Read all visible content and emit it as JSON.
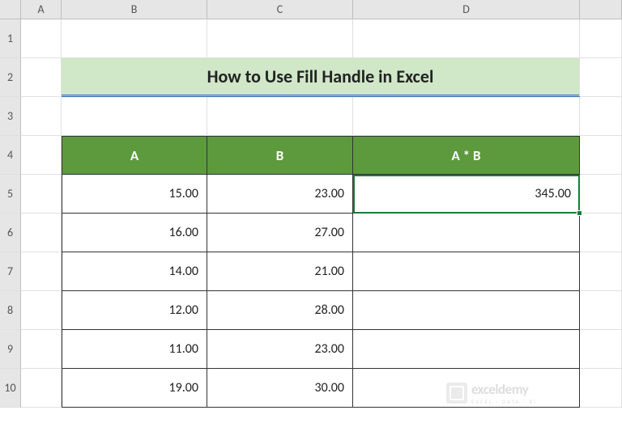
{
  "columns": [
    "A",
    "B",
    "C",
    "D"
  ],
  "rows": [
    "1",
    "2",
    "3",
    "4",
    "5",
    "6",
    "7",
    "8",
    "9",
    "10"
  ],
  "title": "How to Use Fill Handle in Excel",
  "table": {
    "headers": {
      "b": "A",
      "c": "B",
      "d": "A * B"
    },
    "data": [
      {
        "b": "15.00",
        "c": "23.00",
        "d": "345.00"
      },
      {
        "b": "16.00",
        "c": "27.00",
        "d": ""
      },
      {
        "b": "14.00",
        "c": "21.00",
        "d": ""
      },
      {
        "b": "12.00",
        "c": "28.00",
        "d": ""
      },
      {
        "b": "11.00",
        "c": "23.00",
        "d": ""
      },
      {
        "b": "19.00",
        "c": "30.00",
        "d": ""
      }
    ]
  },
  "watermark": {
    "main": "exceldemy",
    "sub": "EXCEL · DATA · BI"
  },
  "chart_data": {
    "type": "table",
    "title": "How to Use Fill Handle in Excel",
    "columns": [
      "A",
      "B",
      "A * B"
    ],
    "rows": [
      [
        15.0,
        23.0,
        345.0
      ],
      [
        16.0,
        27.0,
        null
      ],
      [
        14.0,
        21.0,
        null
      ],
      [
        12.0,
        28.0,
        null
      ],
      [
        11.0,
        23.0,
        null
      ],
      [
        19.0,
        30.0,
        null
      ]
    ]
  }
}
